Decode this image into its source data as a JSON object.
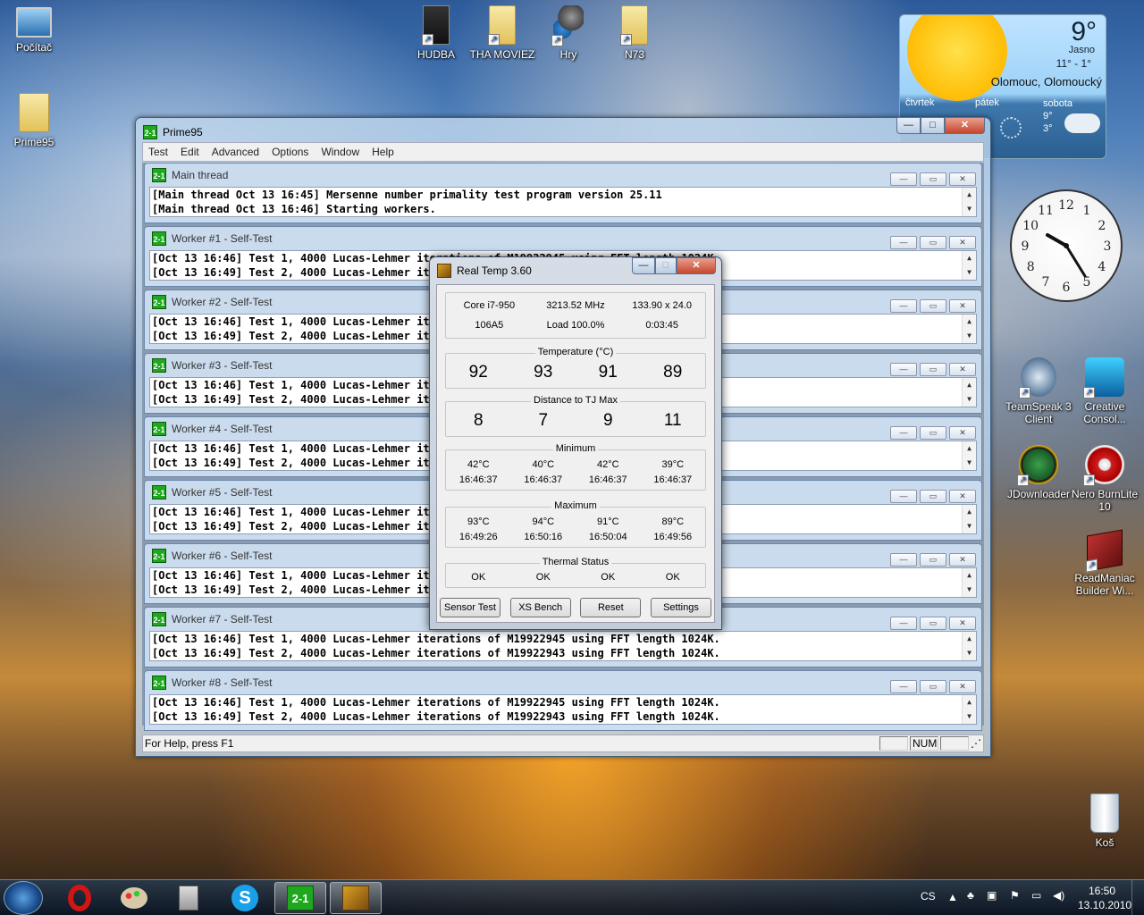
{
  "desktop": {
    "icons": [
      {
        "label": "Počítač"
      },
      {
        "label": "Prime95"
      },
      {
        "label": "HUDBA"
      },
      {
        "label": "THA MOVIEZ"
      },
      {
        "label": "Hry"
      },
      {
        "label": "N73"
      },
      {
        "label": "TeamSpeak 3 Client"
      },
      {
        "label": "Creative Consol..."
      },
      {
        "label": "JDownloader"
      },
      {
        "label": "Nero BurnLite 10"
      },
      {
        "label": "ReadManiac Builder Wi..."
      },
      {
        "label": "Koš"
      }
    ]
  },
  "weather": {
    "temp": "9°",
    "condition": "Jasno",
    "range": "11° - 1°",
    "location": "Olomouc, Olomoucký",
    "days": [
      {
        "name": "čtvrtek"
      },
      {
        "name": "pátek"
      },
      {
        "name": "sobota",
        "hi": "9°",
        "lo": "3°"
      }
    ]
  },
  "clock": {
    "numerals": [
      "12",
      "1",
      "2",
      "3",
      "4",
      "5",
      "6",
      "7",
      "8",
      "9",
      "10",
      "11"
    ]
  },
  "prime95": {
    "title": "Prime95",
    "menu": [
      "Test",
      "Edit",
      "Advanced",
      "Options",
      "Window",
      "Help"
    ],
    "windows": [
      {
        "title": "Main thread",
        "lines": [
          "[Main thread Oct 13 16:45] Mersenne number primality test program version 25.11",
          "[Main thread Oct 13 16:46] Starting workers."
        ]
      },
      {
        "title": "Worker #1 - Self-Test",
        "lines": [
          "[Oct 13 16:46] Test 1, 4000 Lucas-Lehmer iterations of M19922945 using FFT length 1024K.",
          "[Oct 13 16:49] Test 2, 4000 Lucas-Lehmer iterations of M19922943 using FFT length 1024K."
        ]
      },
      {
        "title": "Worker #2 - Self-Test",
        "lines": [
          "[Oct 13 16:46] Test 1, 4000 Lucas-Lehmer iterations of M19922945 using FFT length 1024K.",
          "[Oct 13 16:49] Test 2, 4000 Lucas-Lehmer iterations of M19922943 using FFT length 1024K."
        ]
      },
      {
        "title": "Worker #3 - Self-Test",
        "lines": [
          "[Oct 13 16:46] Test 1, 4000 Lucas-Lehmer iterations of M19922945 using FFT length 1024K.",
          "[Oct 13 16:49] Test 2, 4000 Lucas-Lehmer iterations of M19922943 using FFT length 1024K."
        ]
      },
      {
        "title": "Worker #4 - Self-Test",
        "lines": [
          "[Oct 13 16:46] Test 1, 4000 Lucas-Lehmer iterations of M19922945 using FFT length 1024K.",
          "[Oct 13 16:49] Test 2, 4000 Lucas-Lehmer iterations of M19922943 using FFT length 1024K."
        ]
      },
      {
        "title": "Worker #5 - Self-Test",
        "lines": [
          "[Oct 13 16:46] Test 1, 4000 Lucas-Lehmer iterations of M19922945 using FFT length 1024K.",
          "[Oct 13 16:49] Test 2, 4000 Lucas-Lehmer iterations of M19922943 using FFT length 1024K."
        ]
      },
      {
        "title": "Worker #6 - Self-Test",
        "lines": [
          "[Oct 13 16:46] Test 1, 4000 Lucas-Lehmer iterations of M19922945 using FFT length 1024K.",
          "[Oct 13 16:49] Test 2, 4000 Lucas-Lehmer iterations of M19922943 using FFT length 1024K."
        ]
      },
      {
        "title": "Worker #7 - Self-Test",
        "lines": [
          "[Oct 13 16:46] Test 1, 4000 Lucas-Lehmer iterations of M19922945 using FFT length 1024K.",
          "[Oct 13 16:49] Test 2, 4000 Lucas-Lehmer iterations of M19922943 using FFT length 1024K."
        ]
      },
      {
        "title": "Worker #8 - Self-Test",
        "lines": [
          "[Oct 13 16:46] Test 1, 4000 Lucas-Lehmer iterations of M19922945 using FFT length 1024K.",
          "[Oct 13 16:49] Test 2, 4000 Lucas-Lehmer iterations of M19922943 using FFT length 1024K."
        ]
      }
    ],
    "status": {
      "help": "For Help, press F1",
      "num": "NUM"
    }
  },
  "realtemp": {
    "title": "Real Temp 3.60",
    "info": {
      "cpu": "Core i7-950",
      "freq": "3213.52 MHz",
      "mult": "133.90 x 24.0",
      "cpuid": "106A5",
      "load": "Load 100.0%",
      "time": "0:03:45"
    },
    "temperature": {
      "label": "Temperature (°C)",
      "values": [
        "92",
        "93",
        "91",
        "89"
      ]
    },
    "distance": {
      "label": "Distance to TJ Max",
      "values": [
        "8",
        "7",
        "9",
        "11"
      ]
    },
    "minimum": {
      "label": "Minimum",
      "temps": [
        "42°C",
        "40°C",
        "42°C",
        "39°C"
      ],
      "times": [
        "16:46:37",
        "16:46:37",
        "16:46:37",
        "16:46:37"
      ]
    },
    "maximum": {
      "label": "Maximum",
      "temps": [
        "93°C",
        "94°C",
        "91°C",
        "89°C"
      ],
      "times": [
        "16:49:26",
        "16:50:16",
        "16:50:04",
        "16:49:56"
      ]
    },
    "thermal": {
      "label": "Thermal Status",
      "values": [
        "OK",
        "OK",
        "OK",
        "OK"
      ]
    },
    "buttons": [
      "Sensor Test",
      "XS Bench",
      "Reset",
      "Settings"
    ]
  },
  "taskbar": {
    "lang": "CS",
    "time": "16:50",
    "date": "13.10.2010"
  },
  "colors": {
    "accent": "#1fa81f",
    "close": "#c6452c"
  }
}
